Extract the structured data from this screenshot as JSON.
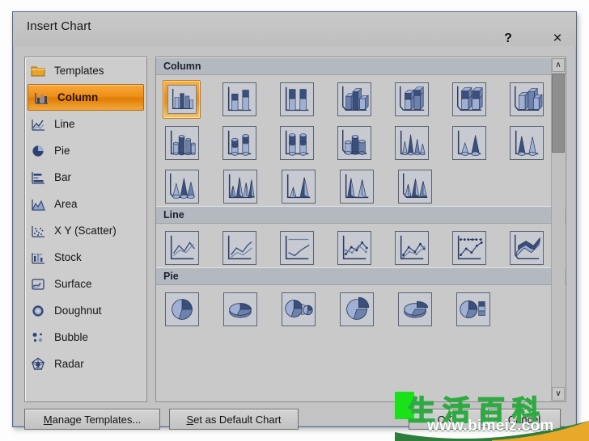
{
  "dialog": {
    "title": "Insert Chart",
    "help_label": "?",
    "close_label": "×"
  },
  "sidebar": {
    "items": [
      {
        "label": "Templates",
        "icon": "folder-icon",
        "selected": false
      },
      {
        "label": "Column",
        "icon": "column-chart-icon",
        "selected": true
      },
      {
        "label": "Line",
        "icon": "line-chart-icon",
        "selected": false
      },
      {
        "label": "Pie",
        "icon": "pie-chart-icon",
        "selected": false
      },
      {
        "label": "Bar",
        "icon": "bar-chart-icon",
        "selected": false
      },
      {
        "label": "Area",
        "icon": "area-chart-icon",
        "selected": false
      },
      {
        "label": "X Y (Scatter)",
        "icon": "scatter-chart-icon",
        "selected": false
      },
      {
        "label": "Stock",
        "icon": "stock-chart-icon",
        "selected": false
      },
      {
        "label": "Surface",
        "icon": "surface-chart-icon",
        "selected": false
      },
      {
        "label": "Doughnut",
        "icon": "doughnut-chart-icon",
        "selected": false
      },
      {
        "label": "Bubble",
        "icon": "bubble-chart-icon",
        "selected": false
      },
      {
        "label": "Radar",
        "icon": "radar-chart-icon",
        "selected": false
      }
    ]
  },
  "gallery": {
    "sections": [
      {
        "title": "Column",
        "rows": [
          [
            {
              "name": "clustered-column",
              "selected": true
            },
            {
              "name": "stacked-column",
              "selected": false
            },
            {
              "name": "100-percent-stacked-column",
              "selected": false
            },
            {
              "name": "3d-clustered-column",
              "selected": false
            },
            {
              "name": "3d-stacked-column",
              "selected": false
            },
            {
              "name": "3d-100-percent-stacked-column",
              "selected": false
            },
            {
              "name": "3d-column",
              "selected": false
            }
          ],
          [
            {
              "name": "clustered-cylinder",
              "selected": false
            },
            {
              "name": "stacked-cylinder",
              "selected": false
            },
            {
              "name": "100-percent-stacked-cylinder",
              "selected": false
            },
            {
              "name": "3d-cylinder",
              "selected": false
            },
            {
              "name": "clustered-cone",
              "selected": false
            },
            {
              "name": "stacked-cone",
              "selected": false
            },
            {
              "name": "100-percent-stacked-cone",
              "selected": false
            }
          ],
          [
            {
              "name": "3d-cone",
              "selected": false
            },
            {
              "name": "clustered-pyramid",
              "selected": false
            },
            {
              "name": "stacked-pyramid",
              "selected": false
            },
            {
              "name": "100-percent-stacked-pyramid",
              "selected": false
            },
            {
              "name": "3d-pyramid",
              "selected": false
            }
          ]
        ]
      },
      {
        "title": "Line",
        "rows": [
          [
            {
              "name": "line",
              "selected": false
            },
            {
              "name": "stacked-line",
              "selected": false
            },
            {
              "name": "100-percent-stacked-line",
              "selected": false
            },
            {
              "name": "line-with-markers",
              "selected": false
            },
            {
              "name": "stacked-line-with-markers",
              "selected": false
            },
            {
              "name": "100-percent-stacked-line-with-markers",
              "selected": false
            },
            {
              "name": "3d-line",
              "selected": false
            }
          ]
        ]
      },
      {
        "title": "Pie",
        "rows": [
          [
            {
              "name": "pie",
              "selected": false
            },
            {
              "name": "pie-in-3d",
              "selected": false
            },
            {
              "name": "pie-of-pie",
              "selected": false
            },
            {
              "name": "exploded-pie",
              "selected": false
            },
            {
              "name": "exploded-pie-in-3d",
              "selected": false
            },
            {
              "name": "bar-of-pie",
              "selected": false
            }
          ]
        ]
      }
    ]
  },
  "scrollbar": {
    "up_arrow": "∧",
    "down_arrow": "∨"
  },
  "footer": {
    "manage_templates": {
      "accel": "M",
      "rest": "anage Templates..."
    },
    "set_default": {
      "accel": "S",
      "rest": "et as Default Chart"
    },
    "ok": "OK",
    "cancel": "Cancel"
  },
  "watermark": {
    "chinese": "生活百科",
    "url": "www.bimeiz.com",
    "green": "#19e219",
    "band_dark": "#2f7d3a",
    "band_gold": "#e8a82a"
  },
  "colors": {
    "accent_orange": "#ef8f18",
    "dialog_bg": "#c3c3c3",
    "pane_bg": "#c9c9c9",
    "border_blue": "#52678f",
    "thumb_ink": "#3b4f7d"
  }
}
